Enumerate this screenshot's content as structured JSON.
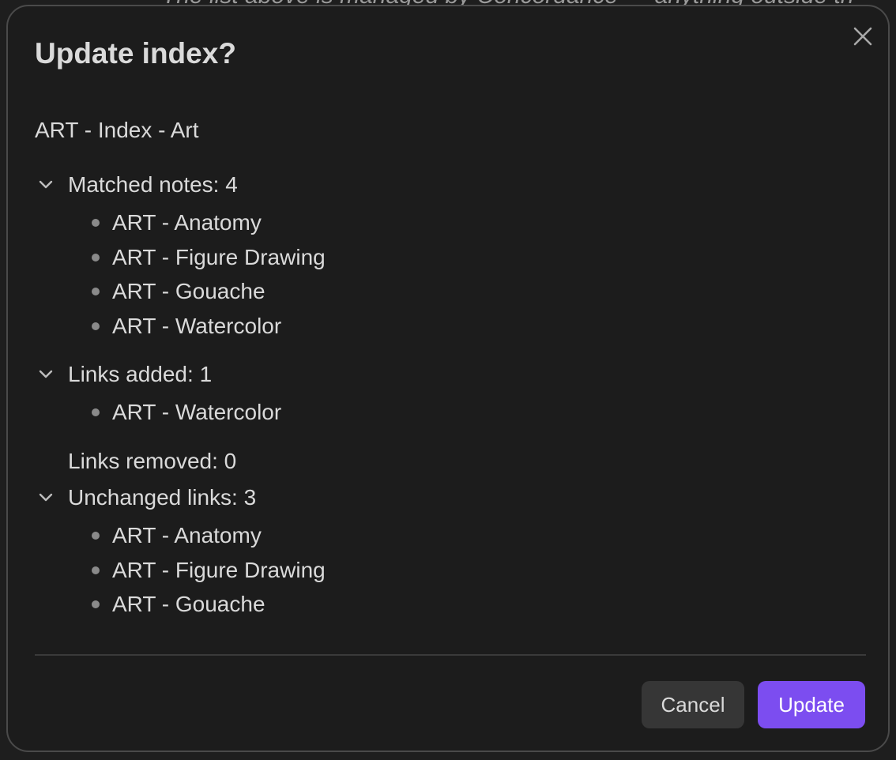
{
  "background": {
    "partial_text": "The list above is managed by Concordance — anything outside th"
  },
  "modal": {
    "title": "Update index?",
    "index_name": "ART - Index - Art",
    "sections": {
      "matched": {
        "label": "Matched notes: 4",
        "items": [
          "ART - Anatomy",
          "ART - Figure Drawing",
          "ART - Gouache",
          "ART - Watercolor"
        ]
      },
      "added": {
        "label": "Links added: 1",
        "items": [
          "ART - Watercolor"
        ]
      },
      "removed": {
        "label": "Links removed: 0"
      },
      "unchanged": {
        "label": "Unchanged links: 3",
        "items": [
          "ART - Anatomy",
          "ART - Figure Drawing",
          "ART - Gouache"
        ]
      }
    },
    "buttons": {
      "cancel": "Cancel",
      "update": "Update"
    }
  },
  "colors": {
    "accent": "#7c4df0",
    "modal_bg": "#1c1c1c",
    "text": "#dadada"
  },
  "icons": {
    "close": "close-icon",
    "chevron": "chevron-down-icon"
  }
}
